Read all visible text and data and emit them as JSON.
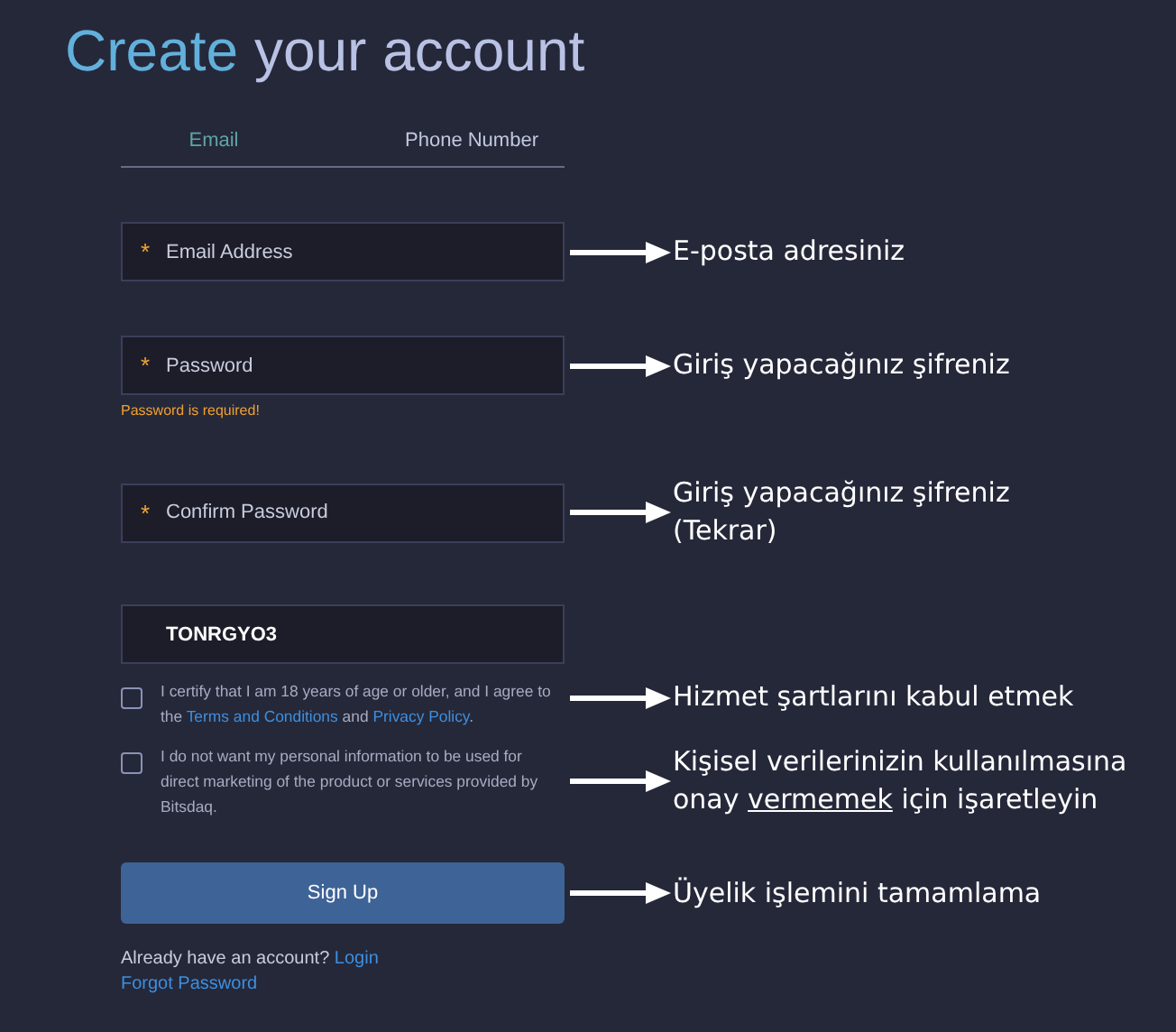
{
  "title": {
    "accent": "Create",
    "rest": "your account"
  },
  "tabs": [
    {
      "label": "Email",
      "selected": true
    },
    {
      "label": "Phone Number",
      "selected": false
    }
  ],
  "rows": [
    {
      "kind": "field",
      "marker": "*",
      "placeholder": "Email Address",
      "annotation": [
        [
          {
            "text": "E-posta adresiniz"
          }
        ]
      ]
    },
    {
      "kind": "field",
      "marker": "*",
      "placeholder": "Password",
      "error": "Password is required!",
      "annotation": [
        [
          {
            "text": "Giriş yapacağınız şifreniz"
          }
        ]
      ]
    },
    {
      "kind": "field",
      "marker": "*",
      "placeholder": "Confirm Password",
      "annotation": [
        [
          {
            "text": "Giriş yapacağınız şifreniz"
          }
        ],
        [
          {
            "text": "(Tekrar)"
          }
        ]
      ]
    },
    {
      "kind": "field",
      "value": "TONRGYO3"
    },
    {
      "kind": "checkbox",
      "checked": false,
      "parts": [
        {
          "text": "I certify that I am 18 years of age or older, and I agree to the "
        },
        {
          "text": "Terms and Conditions",
          "link": true
        },
        {
          "text": " and "
        },
        {
          "text": "Privacy Policy",
          "link": true
        },
        {
          "text": "."
        }
      ],
      "annotation": [
        [
          {
            "text": "Hizmet şartlarını kabul etmek"
          }
        ]
      ]
    },
    {
      "kind": "checkbox",
      "checked": false,
      "parts": [
        {
          "text": "I do not want my personal information to be used for direct marketing of the product or services provided by Bitsdaq."
        }
      ],
      "annotation": [
        [
          {
            "text": "Kişisel verilerinizin kullanılmasına"
          }
        ],
        [
          {
            "text": "onay "
          },
          {
            "text": "vermemek",
            "underline": true
          },
          {
            "text": " için işaretleyin"
          }
        ]
      ]
    },
    {
      "kind": "button",
      "label": "Sign Up",
      "annotation": [
        [
          {
            "text": "Üyelik işlemini tamamlama"
          }
        ]
      ]
    }
  ],
  "footer": {
    "question": "Already have an account?",
    "login": "Login",
    "forgot": "Forgot Password"
  }
}
